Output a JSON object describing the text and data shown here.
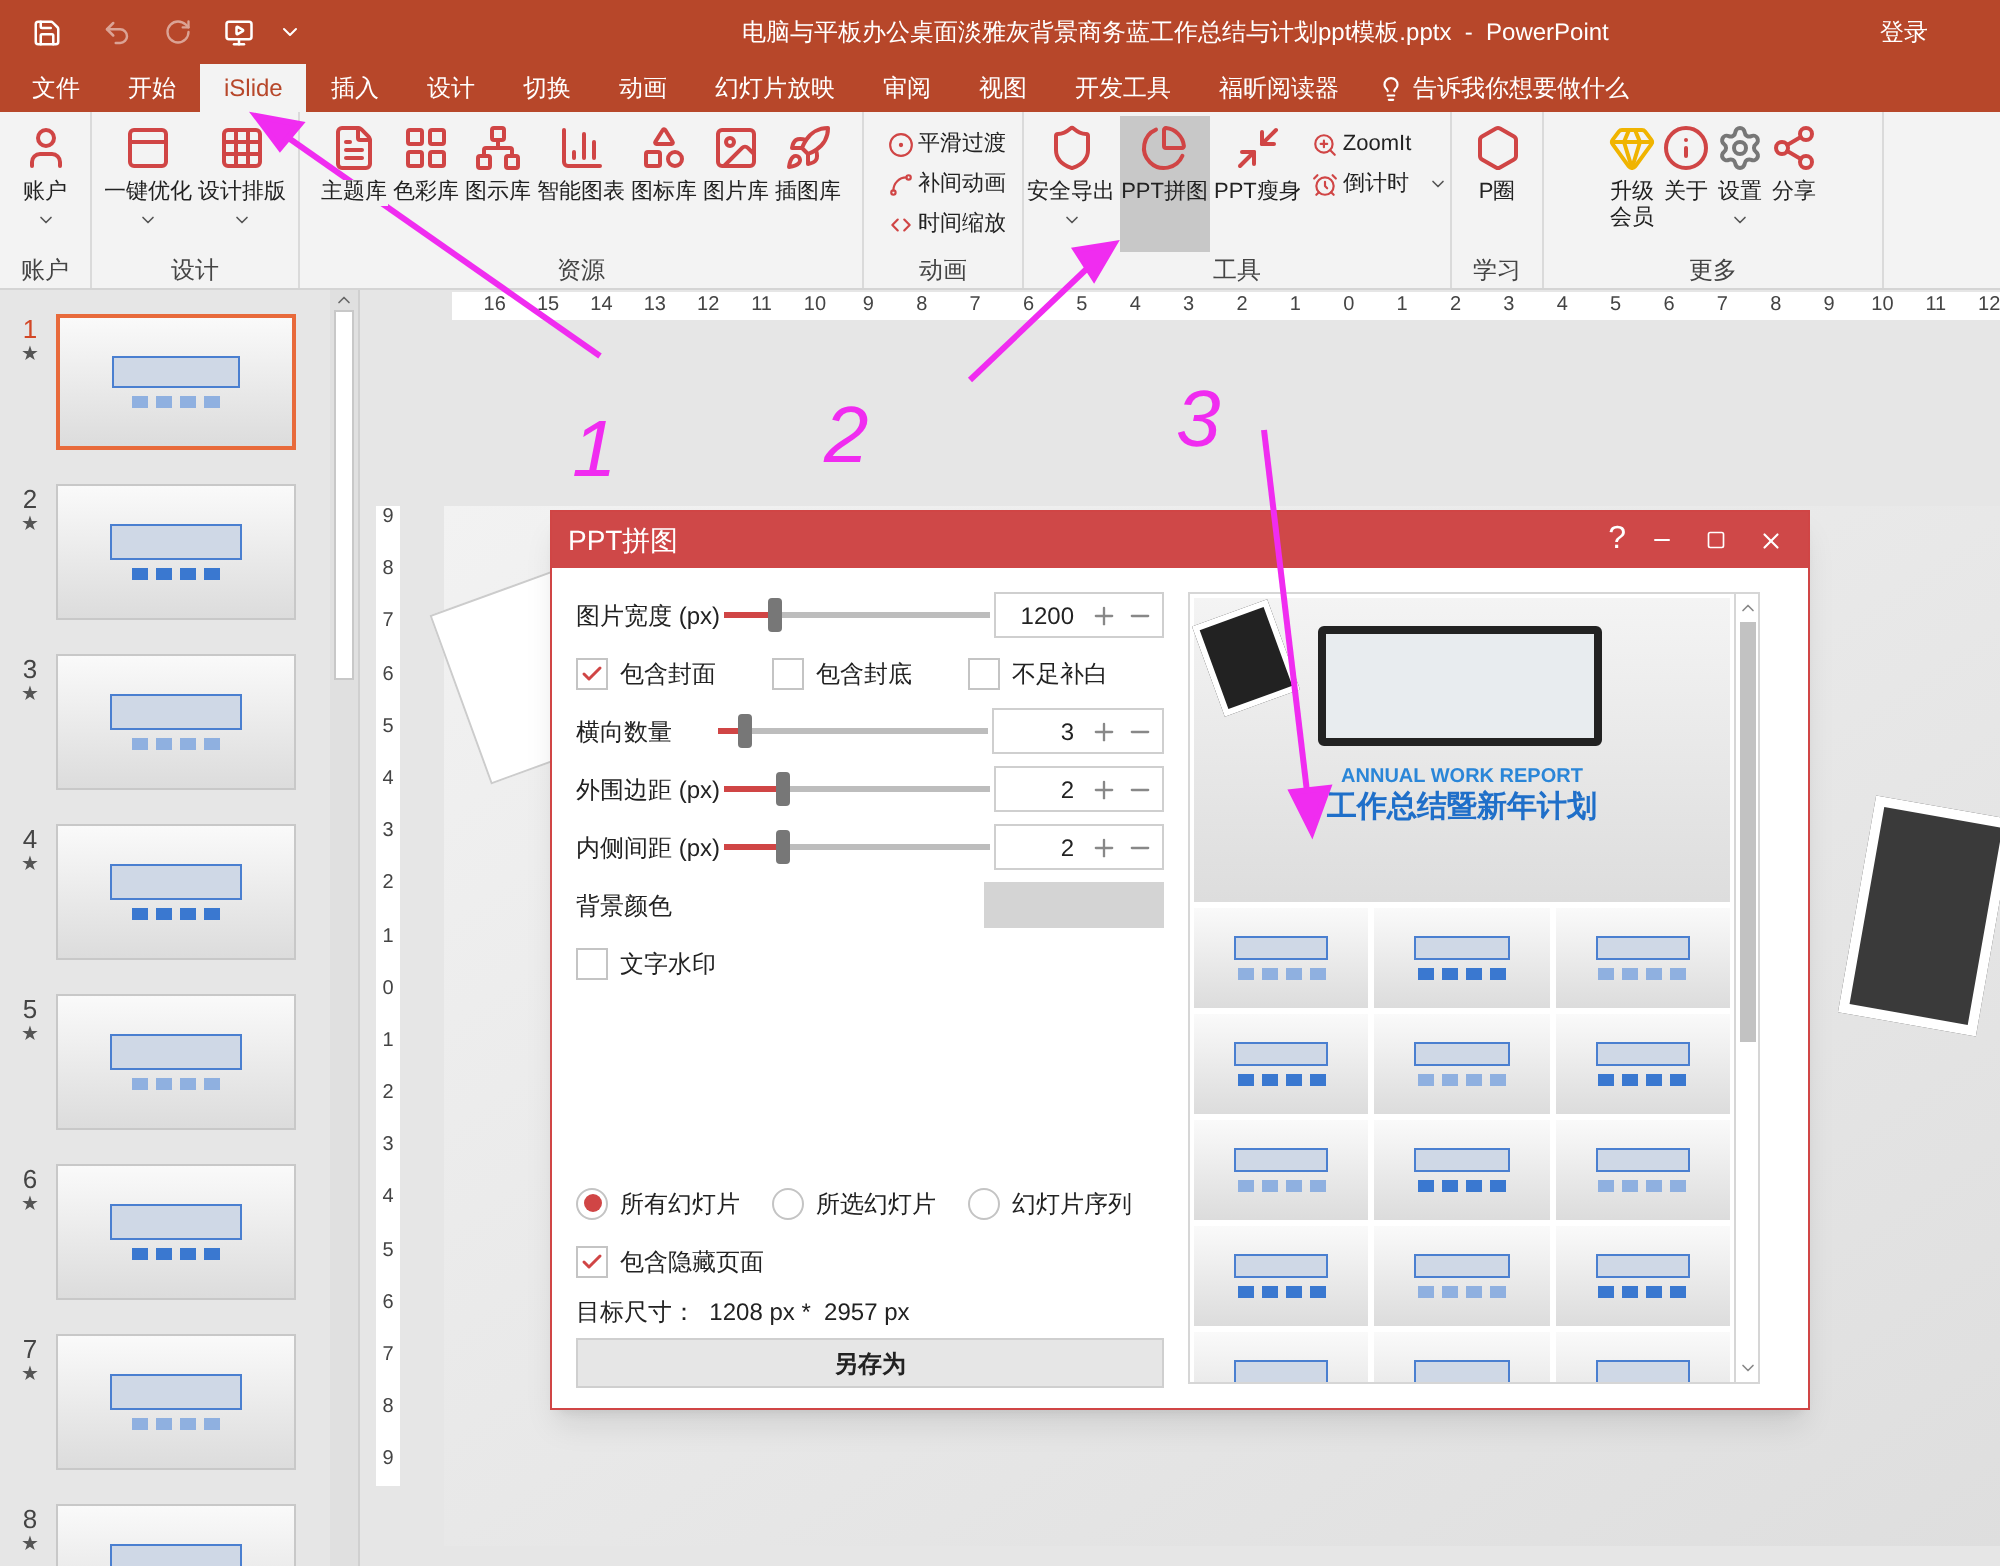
{
  "title_bar": {
    "title": "电脑与平板办公桌面淡雅灰背景商务蓝工作总结与计划ppt模板.pptx  -  PowerPoint",
    "login": "登录"
  },
  "tabs": [
    {
      "label": "文件",
      "selected": false
    },
    {
      "label": "开始",
      "selected": false
    },
    {
      "label": "iSlide",
      "selected": true
    },
    {
      "label": "插入",
      "selected": false
    },
    {
      "label": "设计",
      "selected": false
    },
    {
      "label": "切换",
      "selected": false
    },
    {
      "label": "动画",
      "selected": false
    },
    {
      "label": "幻灯片放映",
      "selected": false
    },
    {
      "label": "审阅",
      "selected": false
    },
    {
      "label": "视图",
      "selected": false
    },
    {
      "label": "开发工具",
      "selected": false
    },
    {
      "label": "福昕阅读器",
      "selected": false
    }
  ],
  "tell_me": "告诉我你想要做什么",
  "ribbon_groups": [
    {
      "label": "账户",
      "items": [
        {
          "kind": "large",
          "label": "账户",
          "dropdown": true,
          "highlighted": false
        }
      ]
    },
    {
      "label": "设计",
      "items": [
        {
          "kind": "large",
          "label": "一键优化",
          "dropdown": true,
          "highlighted": false
        },
        {
          "kind": "large",
          "label": "设计排版",
          "dropdown": true,
          "highlighted": false
        }
      ]
    },
    {
      "label": "资源",
      "items": [
        {
          "kind": "large",
          "label": "主题库",
          "dropdown": false,
          "highlighted": false
        },
        {
          "kind": "large",
          "label": "色彩库",
          "dropdown": false,
          "highlighted": false
        },
        {
          "kind": "large",
          "label": "图示库",
          "dropdown": false,
          "highlighted": false
        },
        {
          "kind": "large",
          "label": "智能图表",
          "dropdown": false,
          "highlighted": false
        },
        {
          "kind": "large",
          "label": "图标库",
          "dropdown": false,
          "highlighted": false
        },
        {
          "kind": "large",
          "label": "图片库",
          "dropdown": false,
          "highlighted": false
        },
        {
          "kind": "large",
          "label": "插图库",
          "dropdown": false,
          "highlighted": false
        }
      ]
    },
    {
      "label": "动画",
      "items": [
        {
          "kind": "small",
          "label": "平滑过渡",
          "dropdown": false,
          "highlighted": false
        },
        {
          "kind": "small",
          "label": "补间动画",
          "dropdown": false,
          "highlighted": false
        },
        {
          "kind": "small",
          "label": "时间缩放",
          "dropdown": false,
          "highlighted": false
        }
      ]
    },
    {
      "label": "工具",
      "items": [
        {
          "kind": "large",
          "label": "安全导出",
          "dropdown": true,
          "highlighted": false
        },
        {
          "kind": "large",
          "label": "PPT拼图",
          "dropdown": false,
          "highlighted": true
        },
        {
          "kind": "large",
          "label": "PPT瘦身",
          "dropdown": false,
          "highlighted": false
        },
        {
          "kind": "small",
          "label": "ZoomIt",
          "dropdown": false,
          "highlighted": false
        },
        {
          "kind": "small",
          "label": "倒计时",
          "dropdown": true,
          "highlighted": false
        }
      ]
    },
    {
      "label": "学习",
      "items": [
        {
          "kind": "large",
          "label": "P圈",
          "dropdown": false,
          "highlighted": false
        }
      ]
    },
    {
      "label": "更多",
      "items": [
        {
          "kind": "large",
          "label": "升级会员",
          "dropdown": false,
          "highlighted": false
        },
        {
          "kind": "large",
          "label": "关于",
          "dropdown": false,
          "highlighted": false
        },
        {
          "kind": "large",
          "label": "设置",
          "dropdown": true,
          "highlighted": false
        },
        {
          "kind": "large",
          "label": "分享",
          "dropdown": false,
          "highlighted": false
        }
      ]
    }
  ],
  "slides": [
    {
      "number": "1",
      "mark": "★",
      "selected": true
    },
    {
      "number": "2",
      "mark": "★",
      "selected": false
    },
    {
      "number": "3",
      "mark": "★",
      "selected": false
    },
    {
      "number": "4",
      "mark": "★",
      "selected": false
    },
    {
      "number": "5",
      "mark": "★",
      "selected": false
    },
    {
      "number": "6",
      "mark": "★",
      "selected": false
    },
    {
      "number": "7",
      "mark": "★",
      "selected": false
    },
    {
      "number": "8",
      "mark": "★",
      "selected": false
    }
  ],
  "ruler": {
    "horizontal": [
      "16",
      "15",
      "14",
      "13",
      "12",
      "11",
      "10",
      "9",
      "8",
      "7",
      "6",
      "5",
      "4",
      "3",
      "2",
      "1",
      "0",
      "1",
      "2",
      "3",
      "4",
      "5",
      "6",
      "7",
      "8",
      "9",
      "10",
      "11",
      "12"
    ],
    "vertical": [
      "9",
      "8",
      "7",
      "6",
      "5",
      "4",
      "3",
      "2",
      "1",
      "0",
      "1",
      "2",
      "3",
      "4",
      "5",
      "6",
      "7",
      "8",
      "9"
    ]
  },
  "dialog": {
    "title": "PPT拼图",
    "help": "?",
    "rows": [
      {
        "kind": "slider",
        "label": "图片宽度 (px)",
        "level": 0.19,
        "value": "1200"
      },
      {
        "kind": "checks",
        "options": [
          {
            "label": "包含封面",
            "checked": true
          },
          {
            "label": "包含封底",
            "checked": false
          },
          {
            "label": "不足补白",
            "checked": false
          }
        ]
      },
      {
        "kind": "slider",
        "label": "横向数量",
        "level": 0.1,
        "value": "3"
      },
      {
        "kind": "slider",
        "label": "外围边距 (px)",
        "level": 0.22,
        "value": "2"
      },
      {
        "kind": "slider",
        "label": "内侧间距 (px)",
        "level": 0.22,
        "value": "2"
      },
      {
        "kind": "color",
        "label": "背景颜色",
        "color": "#d4d4d4"
      },
      {
        "kind": "check",
        "label": "文字水印",
        "checked": false
      }
    ],
    "radios": [
      {
        "label": "所有幻灯片",
        "selected": true
      },
      {
        "label": "所选幻灯片",
        "selected": false
      },
      {
        "label": "幻灯片序列",
        "selected": false
      }
    ],
    "hidden_pages": {
      "label": "包含隐藏页面",
      "checked": true
    },
    "target_size": "目标尺寸：  1208 px *  2957 px",
    "save_button": "另存为",
    "preview": {
      "subtitle": "ANNUAL WORK REPORT",
      "title": "工作总结暨新年计划"
    }
  },
  "annotations": [
    "1",
    "2",
    "3"
  ]
}
